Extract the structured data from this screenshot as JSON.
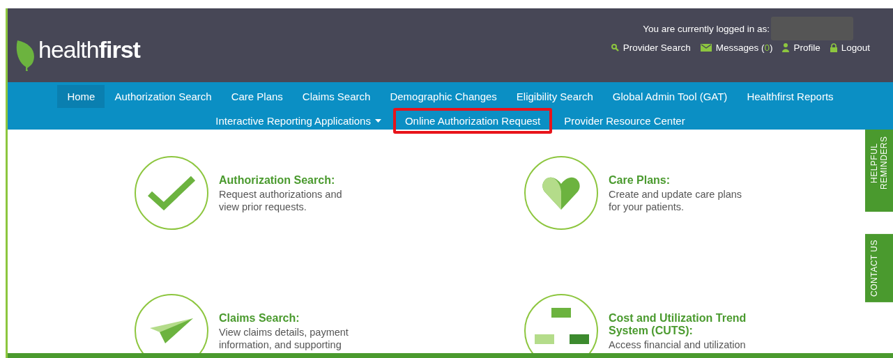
{
  "header": {
    "logo": {
      "light": "health",
      "bold": "first"
    },
    "login_label": "You are currently logged in as:",
    "links": [
      {
        "kind": "search",
        "label": "Provider Search"
      },
      {
        "kind": "mail",
        "label": "Messages (",
        "count": "0",
        "suffix": ")"
      },
      {
        "kind": "person",
        "label": "Profile"
      },
      {
        "kind": "lock",
        "label": "Logout"
      }
    ]
  },
  "nav": {
    "primary": [
      {
        "label": "Home",
        "selected": true,
        "highlighted": false,
        "dropdown": false
      },
      {
        "label": "Authorization Search",
        "selected": false,
        "highlighted": false,
        "dropdown": false
      },
      {
        "label": "Care Plans",
        "selected": false,
        "highlighted": false,
        "dropdown": false
      },
      {
        "label": "Claims Search",
        "selected": false,
        "highlighted": false,
        "dropdown": false
      },
      {
        "label": "Demographic Changes",
        "selected": false,
        "highlighted": false,
        "dropdown": false
      },
      {
        "label": "Eligibility Search",
        "selected": false,
        "highlighted": false,
        "dropdown": false
      },
      {
        "label": "Global Admin Tool (GAT)",
        "selected": false,
        "highlighted": false,
        "dropdown": false
      },
      {
        "label": "Healthfirst Reports",
        "selected": false,
        "highlighted": false,
        "dropdown": false
      }
    ],
    "secondary": [
      {
        "label": "Interactive Reporting Applications",
        "selected": false,
        "highlighted": false,
        "dropdown": true
      },
      {
        "label": "Online Authorization Request",
        "selected": false,
        "highlighted": true,
        "dropdown": false
      },
      {
        "label": "Provider Resource Center",
        "selected": false,
        "highlighted": false,
        "dropdown": false
      }
    ]
  },
  "cards": [
    {
      "kind": "check",
      "title": "Authorization Search:",
      "lines": [
        "Request authorizations and",
        "view prior requests."
      ]
    },
    {
      "kind": "heart",
      "title": "Care Plans:",
      "lines": [
        "Create and update care plans",
        "for your patients."
      ]
    },
    {
      "kind": "plane",
      "title": "Claims Search:",
      "lines": [
        "View claims details, payment",
        "information, and supporting"
      ]
    },
    {
      "kind": "chart",
      "title": "Cost and Utilization Trend System (CUTS):",
      "lines": [
        "Access financial and utilization"
      ]
    }
  ],
  "side_tabs": [
    "HELPFUL REMINDERS",
    "CONTACT US"
  ]
}
